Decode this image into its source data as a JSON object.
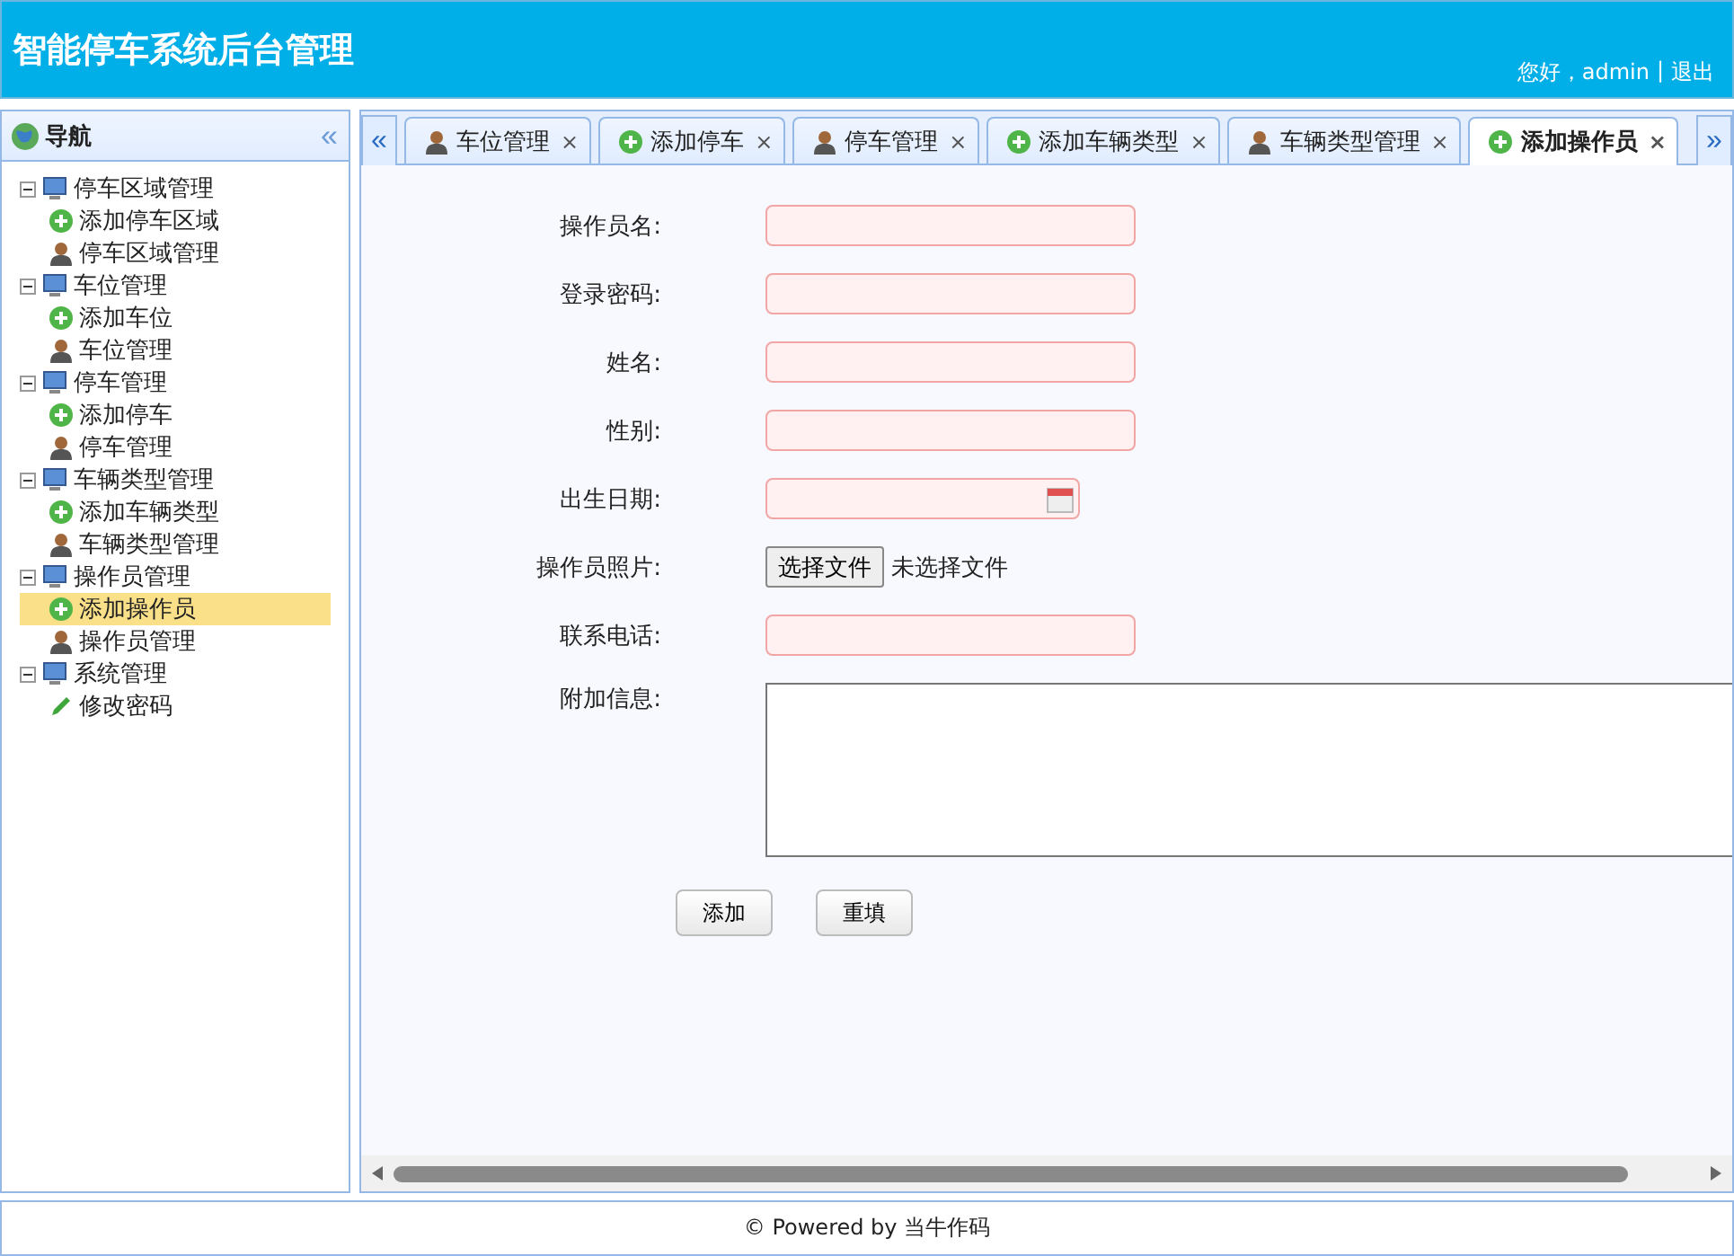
{
  "header": {
    "title": "智能停车系统后台管理",
    "greeting": "您好，admin",
    "separator": "|",
    "logout": "退出"
  },
  "sidebar": {
    "title": "导航",
    "collapse": "«",
    "tree": [
      {
        "label": "停车区域管理",
        "kind": "monitor",
        "expanded": true,
        "selected": false,
        "children": [
          {
            "label": "添加停车区域",
            "kind": "add",
            "selected": false
          },
          {
            "label": "停车区域管理",
            "kind": "user",
            "selected": false
          }
        ]
      },
      {
        "label": "车位管理",
        "kind": "monitor",
        "expanded": true,
        "selected": false,
        "children": [
          {
            "label": "添加车位",
            "kind": "add",
            "selected": false
          },
          {
            "label": "车位管理",
            "kind": "user",
            "selected": false
          }
        ]
      },
      {
        "label": "停车管理",
        "kind": "monitor",
        "expanded": true,
        "selected": false,
        "children": [
          {
            "label": "添加停车",
            "kind": "add",
            "selected": false
          },
          {
            "label": "停车管理",
            "kind": "user",
            "selected": false
          }
        ]
      },
      {
        "label": "车辆类型管理",
        "kind": "monitor",
        "expanded": true,
        "selected": false,
        "children": [
          {
            "label": "添加车辆类型",
            "kind": "add",
            "selected": false
          },
          {
            "label": "车辆类型管理",
            "kind": "user",
            "selected": false
          }
        ]
      },
      {
        "label": "操作员管理",
        "kind": "monitor",
        "expanded": true,
        "selected": false,
        "children": [
          {
            "label": "添加操作员",
            "kind": "add",
            "selected": true
          },
          {
            "label": "操作员管理",
            "kind": "user",
            "selected": false
          }
        ]
      },
      {
        "label": "系统管理",
        "kind": "monitor",
        "expanded": true,
        "selected": false,
        "children": [
          {
            "label": "修改密码",
            "kind": "pencil",
            "selected": false
          }
        ]
      }
    ]
  },
  "tabs": {
    "prev": "«",
    "next": "»",
    "items": [
      {
        "label": "车位管理",
        "kind": "user",
        "selected": false,
        "close": "×"
      },
      {
        "label": "添加停车",
        "kind": "add",
        "selected": false,
        "close": "×"
      },
      {
        "label": "停车管理",
        "kind": "user",
        "selected": false,
        "close": "×"
      },
      {
        "label": "添加车辆类型",
        "kind": "add",
        "selected": false,
        "close": "×"
      },
      {
        "label": "车辆类型管理",
        "kind": "user",
        "selected": false,
        "close": "×"
      },
      {
        "label": "添加操作员",
        "kind": "add",
        "selected": true,
        "close": "×"
      }
    ]
  },
  "form": {
    "fields": [
      {
        "kind": "text",
        "label": "操作员名:"
      },
      {
        "kind": "text",
        "label": "登录密码:"
      },
      {
        "kind": "text",
        "label": "姓名:"
      },
      {
        "kind": "text",
        "label": "性别:"
      },
      {
        "kind": "date",
        "label": "出生日期:"
      },
      {
        "kind": "file",
        "label": "操作员照片:",
        "button": "选择文件",
        "status": "未选择文件"
      },
      {
        "kind": "text",
        "label": "联系电话:"
      },
      {
        "kind": "textarea",
        "label": "附加信息:"
      }
    ],
    "buttons": [
      "添加",
      "重填"
    ]
  },
  "footer": {
    "text": "© Powered by 当牛作码"
  }
}
